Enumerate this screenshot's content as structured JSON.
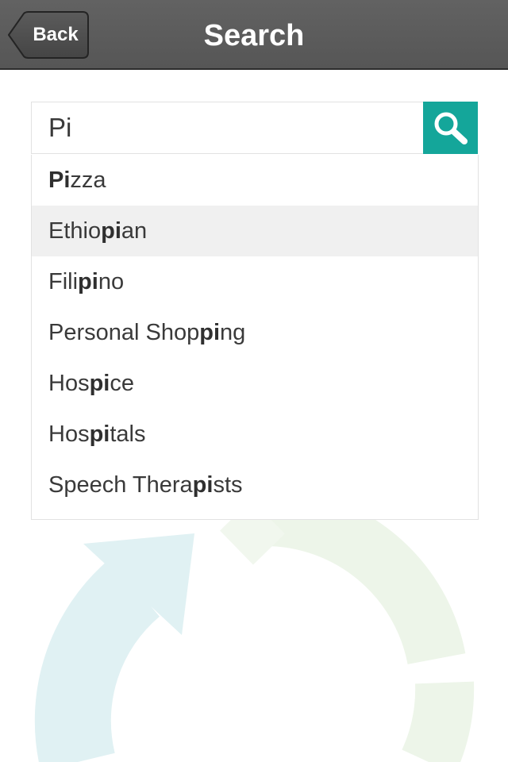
{
  "navbar": {
    "back_label": "Back",
    "title": "Search"
  },
  "search": {
    "query": "Pi",
    "button_icon": "magnifier-icon",
    "accent_color": "#14a69a"
  },
  "suggestions": [
    {
      "pre": "",
      "match": "Pi",
      "post": "zza",
      "highlighted": false
    },
    {
      "pre": "Ethio",
      "match": "pi",
      "post": "an",
      "highlighted": true
    },
    {
      "pre": "Fili",
      "match": "pi",
      "post": "no",
      "highlighted": false
    },
    {
      "pre": "Personal Shop",
      "match": "pi",
      "post": "ng",
      "highlighted": false
    },
    {
      "pre": "Hos",
      "match": "pi",
      "post": "ce",
      "highlighted": false
    },
    {
      "pre": "Hos",
      "match": "pi",
      "post": "tals",
      "highlighted": false
    },
    {
      "pre": "Speech Thera",
      "match": "pi",
      "post": "sts",
      "highlighted": false
    }
  ],
  "background": {
    "logo_icon": "refresh-circle-logo",
    "colors": [
      "#e0f1f3",
      "#eaf4e7"
    ]
  }
}
